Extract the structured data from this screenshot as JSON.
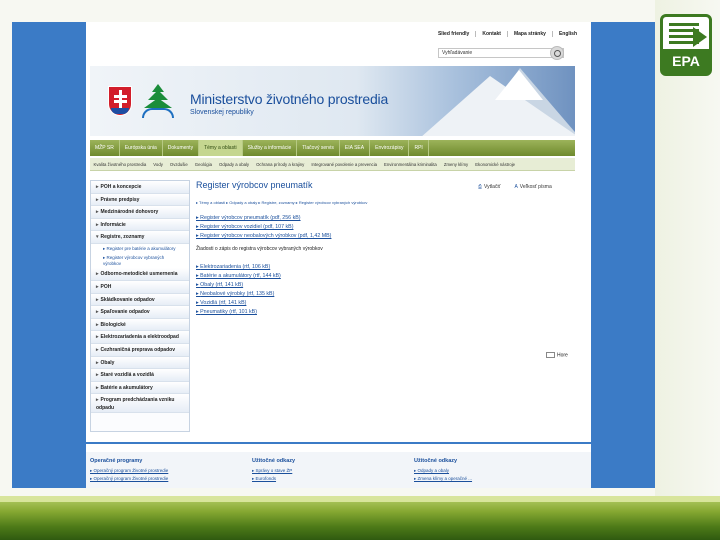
{
  "slide": {
    "logo_label": "EPA"
  },
  "utility": {
    "links": [
      "Slied friendly",
      "Kontakt",
      "Mapa stránky",
      "English"
    ]
  },
  "search": {
    "placeholder": "Vyhľadávanie"
  },
  "banner": {
    "title": "Ministerstvo životného prostredia",
    "subtitle": "Slovenskej republiky"
  },
  "nav": {
    "items": [
      "MŽP SR",
      "Európska únia",
      "Dokumenty",
      "Témy a oblasti",
      "Služby a informácie",
      "Tlačový servis",
      "EIA SEA",
      "Envirozápisy",
      "RPI"
    ],
    "active_index": 3
  },
  "subnav": {
    "items": [
      "Kvalita životného prostredia",
      "Vody",
      "Ovzdušie",
      "Geológia",
      "Odpady a obaly",
      "Ochrana prírody a krajiny",
      "Integrované povolenie a prevencia",
      "Environmentálna kriminalita",
      "Zmeny klímy",
      "Ekonomické nástroje"
    ]
  },
  "sidebar": {
    "items": [
      {
        "label": "POH a koncepcie",
        "tall": false
      },
      {
        "label": "Právne predpisy",
        "tall": false
      },
      {
        "label": "Medzinárodné dohovory",
        "tall": false
      },
      {
        "label": "Informácie",
        "tall": false
      },
      {
        "label": "Registre, zoznamy",
        "tall": false,
        "expanded": true
      },
      {
        "label": "Odborno-metodické usmernenia",
        "tall": false
      },
      {
        "label": "POH",
        "tall": false
      },
      {
        "label": "Skládkovanie odpadov",
        "tall": false
      },
      {
        "label": "Spaľovanie odpadov",
        "tall": false
      },
      {
        "label": "Biologické",
        "tall": false
      },
      {
        "label": "Elektrozariadenia a elektroodpad",
        "tall": false
      },
      {
        "label": "Cezhraničná preprava odpadov",
        "tall": false
      },
      {
        "label": "Obaly",
        "tall": false
      },
      {
        "label": "Staré vozidlá a vozidlá",
        "tall": false
      },
      {
        "label": "Batérie a akumulátory",
        "tall": false
      },
      {
        "label": "Program predchádzania vzniku odpadu",
        "tall": true
      }
    ],
    "subitems": [
      "Register pre batérie a akumulátory",
      "Register výrobcov vybraných výrobkov"
    ]
  },
  "content": {
    "title": "Register výrobcov pneumatík",
    "print_label": "Vytlačiť",
    "font_label": "Veľkosť písma",
    "breadcrumb": "▸ Témy a oblasti ▸ Odpady a obaly ▸ Registre, zoznamy ▸ Register výrobcov vybraných výrobkov",
    "registers": [
      "Register výrobcov pneumatík (pdf, 256 kB)",
      "Register výrobcov vozidiel (pdf, 107 kB)",
      "Register výrobcov neobalových výrobkov (pdf, 1,42 MB)"
    ],
    "intro": "Žiadosti o zápis do registra výrobcov vybraných výrobkov",
    "requests": [
      "Elektrozariadenia (rtf, 106 kB)",
      "Batérie a akumulátory (rtf, 144 kB)",
      "Obaly (rtf, 141 kB)",
      "Neobalové výrobky (rtf, 135 kB)",
      "Vozidlá (rtf, 141 kB)",
      "Pneumatiky (rtf, 101 kB)"
    ],
    "back_to_top": "Hore"
  },
  "footer": {
    "columns": [
      {
        "heading": "Operačné programy",
        "links": [
          "Operačný program Životné prostredie",
          "Operačný program Životné prostredie"
        ]
      },
      {
        "heading": "Užitočné odkazy",
        "links": [
          "Správy o stave ŽP",
          "Eurofonds"
        ]
      },
      {
        "heading": "Užitočné odkazy",
        "links": [
          "Odpady a obaly",
          "Zmena klímy a operačné ..."
        ]
      }
    ]
  }
}
